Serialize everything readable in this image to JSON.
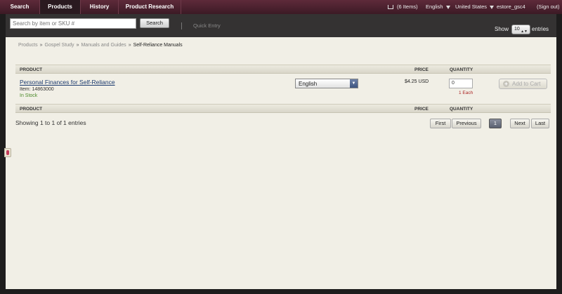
{
  "nav": {
    "tabs": [
      {
        "label": "Search"
      },
      {
        "label": "Products"
      },
      {
        "label": "History"
      },
      {
        "label": "Product Research"
      }
    ],
    "cart_items": "(6 Items)",
    "language": "English",
    "country": "United States",
    "username": "estore_gsc4",
    "sign_out": "(Sign out)"
  },
  "toolbar": {
    "search_placeholder": "Search by item or SKU #",
    "search_button": "Search",
    "quick_entry": "Quick Entry",
    "show_label": "Show",
    "show_value": "10",
    "entries_label": "entries"
  },
  "breadcrumb": {
    "items": [
      "Products",
      "Gospel Study",
      "Manuals and Guides"
    ],
    "current": "Self-Reliance Manuals",
    "separator": "»"
  },
  "table": {
    "headers": {
      "product": "PRODUCT",
      "price": "PRICE",
      "quantity": "QUANTITY"
    },
    "rows": [
      {
        "title": "Personal Finances for Self-Reliance",
        "item": "Item: 14863000",
        "stock": "In Stock",
        "language": "English",
        "price": "$4.25 USD",
        "quantity": "0",
        "unit": "1 Each",
        "add_to_cart": "Add to Cart"
      }
    ]
  },
  "pagination": {
    "showing": "Showing 1 to 1 of 1 entries",
    "first": "First",
    "previous": "Previous",
    "page": "1",
    "next": "Next",
    "last": "Last"
  }
}
